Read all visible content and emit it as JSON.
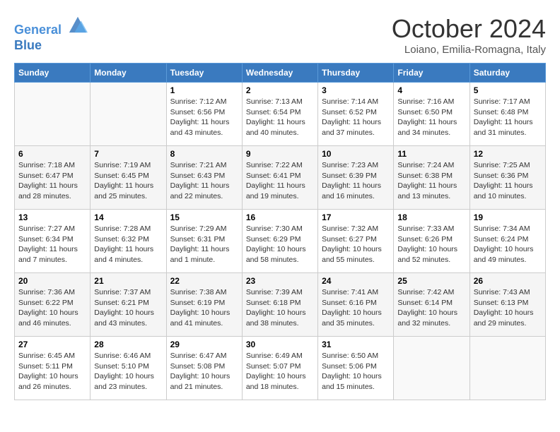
{
  "header": {
    "logo_line1": "General",
    "logo_line2": "Blue",
    "month": "October 2024",
    "location": "Loiano, Emilia-Romagna, Italy"
  },
  "weekdays": [
    "Sunday",
    "Monday",
    "Tuesday",
    "Wednesday",
    "Thursday",
    "Friday",
    "Saturday"
  ],
  "weeks": [
    [
      {
        "day": "",
        "info": ""
      },
      {
        "day": "",
        "info": ""
      },
      {
        "day": "1",
        "info": "Sunrise: 7:12 AM\nSunset: 6:56 PM\nDaylight: 11 hours and 43 minutes."
      },
      {
        "day": "2",
        "info": "Sunrise: 7:13 AM\nSunset: 6:54 PM\nDaylight: 11 hours and 40 minutes."
      },
      {
        "day": "3",
        "info": "Sunrise: 7:14 AM\nSunset: 6:52 PM\nDaylight: 11 hours and 37 minutes."
      },
      {
        "day": "4",
        "info": "Sunrise: 7:16 AM\nSunset: 6:50 PM\nDaylight: 11 hours and 34 minutes."
      },
      {
        "day": "5",
        "info": "Sunrise: 7:17 AM\nSunset: 6:48 PM\nDaylight: 11 hours and 31 minutes."
      }
    ],
    [
      {
        "day": "6",
        "info": "Sunrise: 7:18 AM\nSunset: 6:47 PM\nDaylight: 11 hours and 28 minutes."
      },
      {
        "day": "7",
        "info": "Sunrise: 7:19 AM\nSunset: 6:45 PM\nDaylight: 11 hours and 25 minutes."
      },
      {
        "day": "8",
        "info": "Sunrise: 7:21 AM\nSunset: 6:43 PM\nDaylight: 11 hours and 22 minutes."
      },
      {
        "day": "9",
        "info": "Sunrise: 7:22 AM\nSunset: 6:41 PM\nDaylight: 11 hours and 19 minutes."
      },
      {
        "day": "10",
        "info": "Sunrise: 7:23 AM\nSunset: 6:39 PM\nDaylight: 11 hours and 16 minutes."
      },
      {
        "day": "11",
        "info": "Sunrise: 7:24 AM\nSunset: 6:38 PM\nDaylight: 11 hours and 13 minutes."
      },
      {
        "day": "12",
        "info": "Sunrise: 7:25 AM\nSunset: 6:36 PM\nDaylight: 11 hours and 10 minutes."
      }
    ],
    [
      {
        "day": "13",
        "info": "Sunrise: 7:27 AM\nSunset: 6:34 PM\nDaylight: 11 hours and 7 minutes."
      },
      {
        "day": "14",
        "info": "Sunrise: 7:28 AM\nSunset: 6:32 PM\nDaylight: 11 hours and 4 minutes."
      },
      {
        "day": "15",
        "info": "Sunrise: 7:29 AM\nSunset: 6:31 PM\nDaylight: 11 hours and 1 minute."
      },
      {
        "day": "16",
        "info": "Sunrise: 7:30 AM\nSunset: 6:29 PM\nDaylight: 10 hours and 58 minutes."
      },
      {
        "day": "17",
        "info": "Sunrise: 7:32 AM\nSunset: 6:27 PM\nDaylight: 10 hours and 55 minutes."
      },
      {
        "day": "18",
        "info": "Sunrise: 7:33 AM\nSunset: 6:26 PM\nDaylight: 10 hours and 52 minutes."
      },
      {
        "day": "19",
        "info": "Sunrise: 7:34 AM\nSunset: 6:24 PM\nDaylight: 10 hours and 49 minutes."
      }
    ],
    [
      {
        "day": "20",
        "info": "Sunrise: 7:36 AM\nSunset: 6:22 PM\nDaylight: 10 hours and 46 minutes."
      },
      {
        "day": "21",
        "info": "Sunrise: 7:37 AM\nSunset: 6:21 PM\nDaylight: 10 hours and 43 minutes."
      },
      {
        "day": "22",
        "info": "Sunrise: 7:38 AM\nSunset: 6:19 PM\nDaylight: 10 hours and 41 minutes."
      },
      {
        "day": "23",
        "info": "Sunrise: 7:39 AM\nSunset: 6:18 PM\nDaylight: 10 hours and 38 minutes."
      },
      {
        "day": "24",
        "info": "Sunrise: 7:41 AM\nSunset: 6:16 PM\nDaylight: 10 hours and 35 minutes."
      },
      {
        "day": "25",
        "info": "Sunrise: 7:42 AM\nSunset: 6:14 PM\nDaylight: 10 hours and 32 minutes."
      },
      {
        "day": "26",
        "info": "Sunrise: 7:43 AM\nSunset: 6:13 PM\nDaylight: 10 hours and 29 minutes."
      }
    ],
    [
      {
        "day": "27",
        "info": "Sunrise: 6:45 AM\nSunset: 5:11 PM\nDaylight: 10 hours and 26 minutes."
      },
      {
        "day": "28",
        "info": "Sunrise: 6:46 AM\nSunset: 5:10 PM\nDaylight: 10 hours and 23 minutes."
      },
      {
        "day": "29",
        "info": "Sunrise: 6:47 AM\nSunset: 5:08 PM\nDaylight: 10 hours and 21 minutes."
      },
      {
        "day": "30",
        "info": "Sunrise: 6:49 AM\nSunset: 5:07 PM\nDaylight: 10 hours and 18 minutes."
      },
      {
        "day": "31",
        "info": "Sunrise: 6:50 AM\nSunset: 5:06 PM\nDaylight: 10 hours and 15 minutes."
      },
      {
        "day": "",
        "info": ""
      },
      {
        "day": "",
        "info": ""
      }
    ]
  ]
}
